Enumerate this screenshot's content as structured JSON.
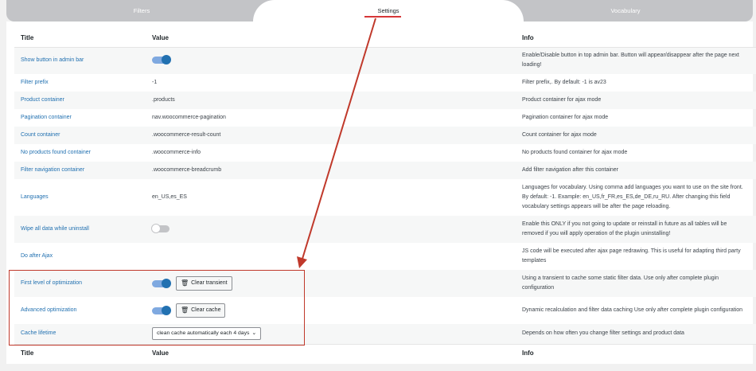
{
  "tabs": [
    {
      "label": "Filters"
    },
    {
      "label": "Settings"
    },
    {
      "label": "Vocabulary"
    }
  ],
  "table": {
    "headers": {
      "title": "Title",
      "value": "Value",
      "info": "Info"
    },
    "rows": [
      {
        "title": "Show button in admin bar",
        "value": "",
        "info": "Enable/Disable button in top admin bar. Button will appear/disappear after the page next loading!"
      },
      {
        "title": "Filter prefix",
        "value": "-1",
        "info": "Filter prefix,. By default: -1 is av23"
      },
      {
        "title": "Product container",
        "value": ".products",
        "info": "Product container for ajax mode"
      },
      {
        "title": "Pagination container",
        "value": "nav.woocommerce-pagination",
        "info": "Pagination container for ajax mode"
      },
      {
        "title": "Count container",
        "value": ".woocommerce-result-count",
        "info": "Count container for ajax mode"
      },
      {
        "title": "No products found container",
        "value": ".woocommerce-info",
        "info": "No products found container for ajax mode"
      },
      {
        "title": "Filter navigation container",
        "value": ".woocommerce-breadcrumb",
        "info": "Add filter navigation after this container"
      },
      {
        "title": "Languages",
        "value": "en_US,es_ES",
        "info": "Languages for vocabulary. Using comma add languages you want to use on the site front. By default: -1. Example: en_US,fr_FR,es_ES,de_DE,ru_RU. After changing this field vocabulary settings appears will be after the page reloading."
      },
      {
        "title": "Wipe all data while uninstall",
        "value": "",
        "info": "Enable this ONLY if you not going to update or reinstall in future as all tables will be removed if you will apply operation of the plugin uninstalling!"
      },
      {
        "title": "Do after Ajax",
        "value": "",
        "info": "JS code will be executed after ajax page redrawing. This is useful for adapting third party templates"
      },
      {
        "title": "First level of optimization",
        "value": "",
        "info": "Using a transient to cache some static filter data. Use only after complete plugin configuration",
        "button": "Clear transient"
      },
      {
        "title": "Advanced optimization",
        "value": "",
        "info": "Dynamic recalculation and filter data caching Use only after complete plugin configuration",
        "button": "Clear cache"
      },
      {
        "title": "Cache lifetime",
        "value": "clean cache automatically each 4 days",
        "info": "Depends on how often you change filter settings and product data"
      }
    ]
  },
  "toggles": {
    "admin_bar": true,
    "wipe_data": false,
    "first_level": true,
    "advanced": true
  },
  "icons": {
    "trash": "trash-icon",
    "chevron": "chevron-down-icon"
  },
  "colors": {
    "accent": "#2271b1",
    "highlight": "#c0392b"
  }
}
